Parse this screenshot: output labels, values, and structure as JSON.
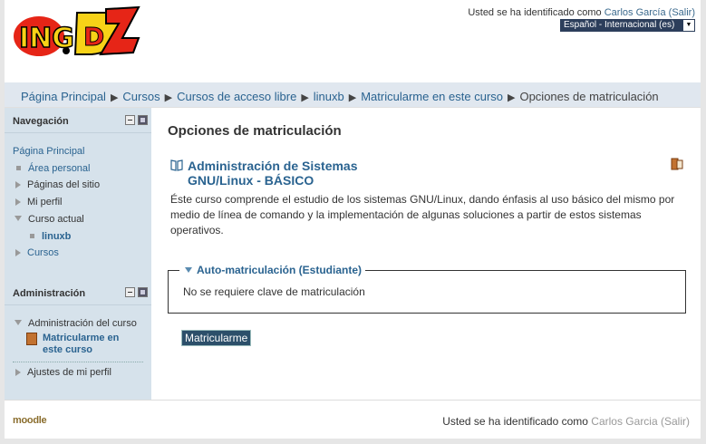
{
  "header": {
    "logo_alt": "ING DZ",
    "login_prefix": "Usted se ha identificado como ",
    "user_name": "Carlos García",
    "logout_label": "(Salir)",
    "language": "Español - Internacional (es)"
  },
  "breadcrumb": {
    "items": [
      "Página Principal",
      "Cursos",
      "Cursos de acceso libre",
      "linuxb",
      "Matricularme en este curso"
    ],
    "current": "Opciones de matriculación"
  },
  "navigation_block": {
    "title": "Navegación",
    "home": "Página Principal",
    "items": [
      "Área personal",
      "Páginas del sitio",
      "Mi perfil",
      "Curso actual",
      "linuxb",
      "Cursos"
    ]
  },
  "admin_block": {
    "title": "Administración",
    "course_admin": "Administración del curso",
    "enrol_link": "Matricularme en este curso",
    "profile_settings": "Ajustes de mi perfil"
  },
  "main": {
    "heading": "Opciones de matriculación",
    "course_title_line1": "Administración de Sistemas",
    "course_title_line2": "GNU/Linux - BÁSICO",
    "summary": "Éste curso comprende el estudio de los sistemas GNU/Linux, dando énfasis al uso básico del mismo por medio de línea de comando y la implementación de algunas soluciones a partir de estos sistemas operativos.",
    "enrol_section_title": "Auto-matriculación (Estudiante)",
    "enrol_note": "No se requiere clave de matriculación",
    "enrol_button": "Matricularme"
  },
  "footer": {
    "moodle": "moodle",
    "login_prefix": "Usted se ha identificado como ",
    "user_name": "Carlos Garcia",
    "logout_label": "(Salir)"
  },
  "colors": {
    "link": "#2a6390",
    "sidebar_bg": "#d6e2eb",
    "navbar_bg": "#e0e7ef",
    "button_bg": "#2c4f6a"
  }
}
